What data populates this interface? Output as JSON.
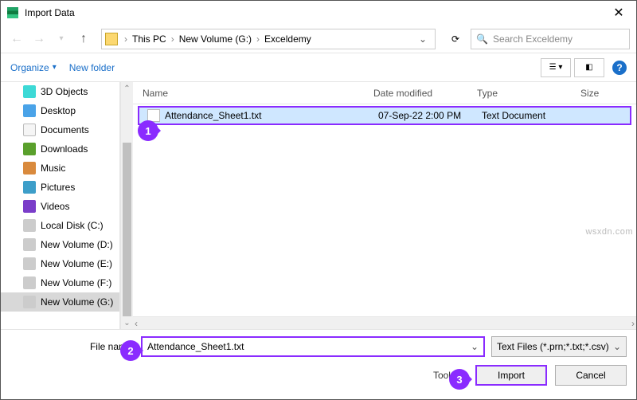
{
  "window": {
    "title": "Import Data"
  },
  "breadcrumb": {
    "root": "This PC",
    "drive": "New Volume (G:)",
    "folder": "Exceldemy"
  },
  "search": {
    "placeholder": "Search Exceldemy"
  },
  "toolbar": {
    "organize": "Organize",
    "newfolder": "New folder"
  },
  "sidebar": {
    "items": [
      {
        "label": "3D Objects"
      },
      {
        "label": "Desktop"
      },
      {
        "label": "Documents"
      },
      {
        "label": "Downloads"
      },
      {
        "label": "Music"
      },
      {
        "label": "Pictures"
      },
      {
        "label": "Videos"
      },
      {
        "label": "Local Disk (C:)"
      },
      {
        "label": "New Volume (D:)"
      },
      {
        "label": "New Volume (E:)"
      },
      {
        "label": "New Volume (F:)"
      },
      {
        "label": "New Volume (G:)"
      }
    ]
  },
  "columns": {
    "name": "Name",
    "date": "Date modified",
    "type": "Type",
    "size": "Size"
  },
  "files": [
    {
      "name": "Attendance_Sheet1.txt",
      "date": "07-Sep-22 2:00 PM",
      "type": "Text Document"
    }
  ],
  "footer": {
    "filename_label": "File name:",
    "filename_value": "Attendance_Sheet1.txt",
    "filter": "Text Files (*.prn;*.txt;*.csv)",
    "tools": "Tools",
    "import": "Import",
    "cancel": "Cancel"
  },
  "callouts": {
    "one": "1",
    "two": "2",
    "three": "3"
  },
  "watermark": "wsxdn.com"
}
